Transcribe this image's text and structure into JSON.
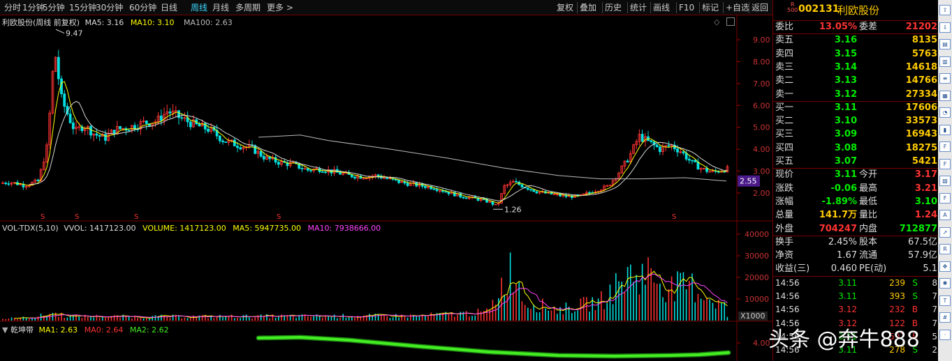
{
  "toolbar": {
    "left_items": [
      "分时",
      "1分钟",
      "5分钟",
      "15分钟",
      "30分钟",
      "60分钟",
      "日线",
      "周线",
      "月线",
      "多周期",
      "更多 >"
    ],
    "active_index": 7,
    "right_items": [
      "复权",
      "叠加",
      "历史",
      "统计",
      "画线",
      "F10",
      "标记",
      "+自选",
      "返回"
    ]
  },
  "main_chart": {
    "stock_label": "利欧股份(周线 前复权)",
    "ma5": "MA5: 3.16",
    "ma10": "MA10: 3.10",
    "ma100": "MA100: 2.63",
    "high_marker": "9.47",
    "low_marker": "1.26",
    "current_price_tag": "2.55",
    "y_ticks": [
      "9.00",
      "8.00",
      "7.00",
      "6.00",
      "5.00",
      "4.00",
      "3.00",
      "2.00"
    ],
    "s_marker": "S"
  },
  "volume_chart": {
    "label": "VOL-TDX(5,10)",
    "vvol": "VVOL: 1417123.00",
    "volume": "VOLUME: 1417123.00",
    "ma5": "MA5: 5947735.00",
    "ma10": "MA10: 7938666.00",
    "y_ticks": [
      "40000",
      "30000",
      "20000",
      "10000"
    ],
    "unit": "X1000"
  },
  "band_chart": {
    "label": "乾坤带",
    "ma1": "MA1: 2.63",
    "ma0": "MA0: 2.64",
    "ma2": "MA2: 2.62",
    "y_tick": "4.00"
  },
  "quote": {
    "badge_top": "R",
    "badge_bottom": "500",
    "code": "002131",
    "name": "利欧股份",
    "weibi_label": "委比",
    "weibi_value": "13.05%",
    "weicha_label": "委差",
    "weicha_value": "21202",
    "sells": [
      {
        "label": "卖五",
        "price": "3.16",
        "vol": "8135"
      },
      {
        "label": "卖四",
        "price": "3.15",
        "vol": "5763"
      },
      {
        "label": "卖三",
        "price": "3.14",
        "vol": "14618"
      },
      {
        "label": "卖二",
        "price": "3.13",
        "vol": "14766"
      },
      {
        "label": "卖一",
        "price": "3.12",
        "vol": "27334"
      }
    ],
    "buys": [
      {
        "label": "买一",
        "price": "3.11",
        "vol": "17606"
      },
      {
        "label": "买二",
        "price": "3.10",
        "vol": "33573"
      },
      {
        "label": "买三",
        "price": "3.09",
        "vol": "16943"
      },
      {
        "label": "买四",
        "price": "3.08",
        "vol": "18275"
      },
      {
        "label": "买五",
        "price": "3.07",
        "vol": "5421"
      }
    ],
    "stats": [
      {
        "l1": "现价",
        "v1": "3.11",
        "l2": "今开",
        "v2": "3.17"
      },
      {
        "l1": "涨跌",
        "v1": "-0.06",
        "l2": "最高",
        "v2": "3.21"
      },
      {
        "l1": "涨幅",
        "v1": "-1.89%",
        "l2": "最低",
        "v2": "3.10"
      },
      {
        "l1": "总量",
        "v1": "141.7万",
        "l2": "量比",
        "v2": "1.24"
      },
      {
        "l1": "外盘",
        "v1": "704247",
        "l2": "内盘",
        "v2": "712877"
      }
    ],
    "stats2": [
      {
        "l1": "换手",
        "v1": "2.45%",
        "l2": "股本",
        "v2": "67.5亿"
      },
      {
        "l1": "净资",
        "v1": "1.67",
        "l2": "流通",
        "v2": "57.9亿"
      },
      {
        "l1": "收益(三)",
        "v1": "0.460",
        "l2": "PE(动)",
        "v2": "5.1"
      }
    ],
    "ticks": [
      {
        "time": "14:56",
        "price": "3.11",
        "vol": "239",
        "side": "S",
        "n": "8"
      },
      {
        "time": "14:56",
        "price": "3.11",
        "vol": "393",
        "side": "S",
        "n": "7"
      },
      {
        "time": "14:56",
        "price": "3.12",
        "vol": "232",
        "side": "B",
        "n": "7"
      },
      {
        "time": "14:56",
        "price": "3.12",
        "vol": "122",
        "side": "B",
        "n": "7"
      },
      {
        "time": "14:56",
        "price": "3.11",
        "vol": "597",
        "side": "B",
        "n": "5"
      },
      {
        "time": "14:56",
        "price": "3.11",
        "vol": "278",
        "side": "S",
        "n": "2"
      }
    ]
  },
  "watermark": "头条 @奔牛888",
  "colors": {
    "up": "#ff3333",
    "down": "#00e0e0",
    "ma_yellow": "#ffff00",
    "ma_white": "#d8d8d8",
    "ma10_magenta": "#ff44ff",
    "band_green": "#44ee22",
    "price_green": "#00ee00",
    "price_red": "#ff3333",
    "gold": "#ffcc00"
  }
}
